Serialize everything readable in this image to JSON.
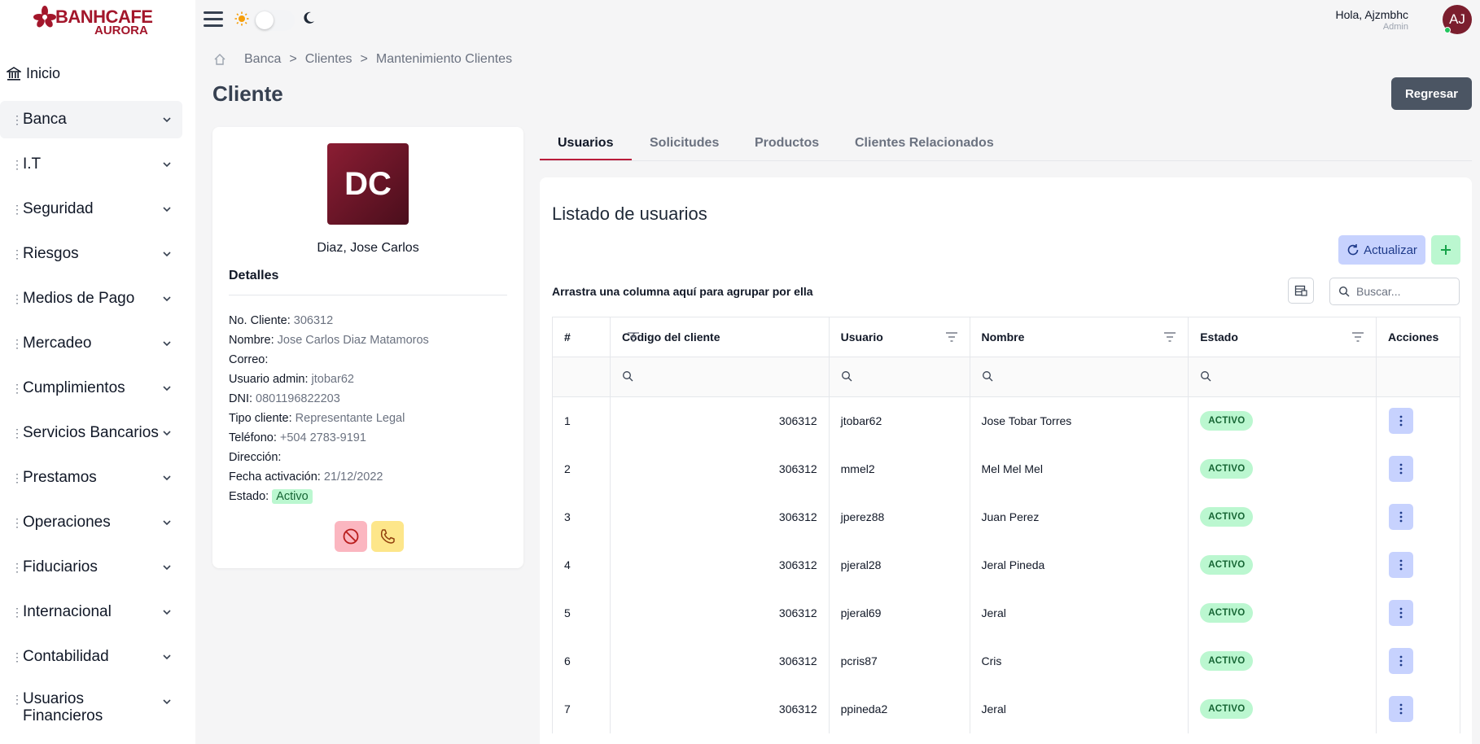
{
  "brand": {
    "name": "BANHCAFE",
    "sub": "AURORA",
    "color": "#a3162b"
  },
  "sidebar": {
    "home": "Inicio",
    "items": [
      {
        "label": "Banca"
      },
      {
        "label": "I.T"
      },
      {
        "label": "Seguridad"
      },
      {
        "label": "Riesgos"
      },
      {
        "label": "Medios de Pago"
      },
      {
        "label": "Mercadeo"
      },
      {
        "label": "Cumplimientos"
      },
      {
        "label": "Servicios Bancarios"
      },
      {
        "label": "Prestamos"
      },
      {
        "label": "Operaciones"
      },
      {
        "label": "Fiduciarios"
      },
      {
        "label": "Internacional"
      },
      {
        "label": "Contabilidad"
      },
      {
        "label": "Usuarios Financieros"
      }
    ]
  },
  "topbar": {
    "greeting": "Hola, Ajzmbhc",
    "role": "Admin",
    "avatar_initials": "AJ"
  },
  "breadcrumb": [
    "Banca",
    "Clientes",
    "Mantenimiento Clientes"
  ],
  "page": {
    "title": "Cliente",
    "back_button": "Regresar"
  },
  "client": {
    "initials": "DC",
    "name": "Diaz, Jose Carlos",
    "details_title": "Detalles",
    "fields": [
      {
        "label": "No. Cliente:",
        "value": "306312"
      },
      {
        "label": "Nombre:",
        "value": "Jose Carlos Diaz Matamoros"
      },
      {
        "label": "Correo:",
        "value": ""
      },
      {
        "label": "Usuario admin:",
        "value": "jtobar62"
      },
      {
        "label": "DNI:",
        "value": "0801196822203"
      },
      {
        "label": "Tipo cliente:",
        "value": "Representante Legal"
      },
      {
        "label": "Teléfono:",
        "value": "+504 2783-9191"
      },
      {
        "label": "Dirección:",
        "value": ""
      },
      {
        "label": "Fecha activación:",
        "value": "21/12/2022"
      }
    ],
    "status_label": "Estado:",
    "status_value": "Activo"
  },
  "tabs": [
    "Usuarios",
    "Solicitudes",
    "Productos",
    "Clientes Relacionados"
  ],
  "users": {
    "title": "Listado de usuarios",
    "refresh_button": "Actualizar",
    "group_hint": "Arrastra una columna aquí para agrupar por ella",
    "search_placeholder": "Buscar...",
    "columns": [
      "#",
      "Código del cliente",
      "Usuario",
      "Nombre",
      "Estado",
      "Acciones"
    ],
    "rows": [
      {
        "n": "1",
        "code": "306312",
        "user": "jtobar62",
        "name": "Jose Tobar Torres",
        "status": "ACTIVO"
      },
      {
        "n": "2",
        "code": "306312",
        "user": "mmel2",
        "name": "Mel Mel Mel",
        "status": "ACTIVO"
      },
      {
        "n": "3",
        "code": "306312",
        "user": "jperez88",
        "name": "Juan Perez",
        "status": "ACTIVO"
      },
      {
        "n": "4",
        "code": "306312",
        "user": "pjeral28",
        "name": "Jeral Pineda",
        "status": "ACTIVO"
      },
      {
        "n": "5",
        "code": "306312",
        "user": "pjeral69",
        "name": "Jeral",
        "status": "ACTIVO"
      },
      {
        "n": "6",
        "code": "306312",
        "user": "pcris87",
        "name": "Cris",
        "status": "ACTIVO"
      },
      {
        "n": "7",
        "code": "306312",
        "user": "ppineda2",
        "name": "Jeral",
        "status": "ACTIVO"
      }
    ]
  },
  "colors": {
    "accent": "#b91c3a",
    "status_green": "#bbf7d0",
    "action_blue": "#c7d2fe"
  }
}
